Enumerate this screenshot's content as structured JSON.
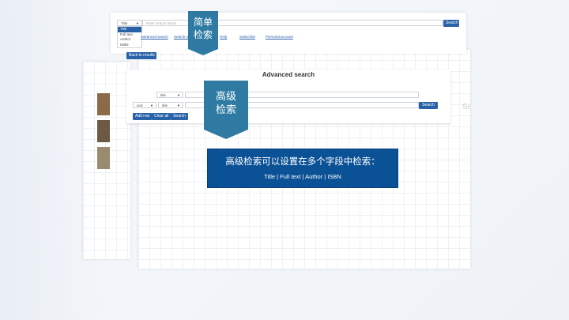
{
  "search_bar": {
    "field_selected": "Title",
    "placeholder": "Enter search terms",
    "search_label": "Search",
    "dropdown_options": [
      "Title",
      "Full text",
      "Author",
      "ISBN"
    ]
  },
  "nav_links": [
    "Advanced search",
    "Search results",
    "Help",
    "Subscribe",
    "Personal account"
  ],
  "back_button": "Back to results",
  "advanced": {
    "heading": "Advanced search",
    "row1_field": "title",
    "row2_operator": "and",
    "row2_field": "title",
    "search_right_label": "Search",
    "add_row": "Add row",
    "clear_all": "Clear all",
    "search_label": "Search"
  },
  "back_panel": {
    "partial_label": "Search"
  },
  "ribbon_simple": {
    "line1": "简单",
    "line2": "检索"
  },
  "ribbon_advanced": {
    "line1": "高级",
    "line2": "检索"
  },
  "callout": {
    "title": "高级检索可以设置在多个字段中检索：",
    "fields": "Title | Full text | Author | ISBN"
  },
  "colors": {
    "ribbon": "#2e7aa2",
    "callout": "#0b5196",
    "button": "#2a62a8"
  }
}
